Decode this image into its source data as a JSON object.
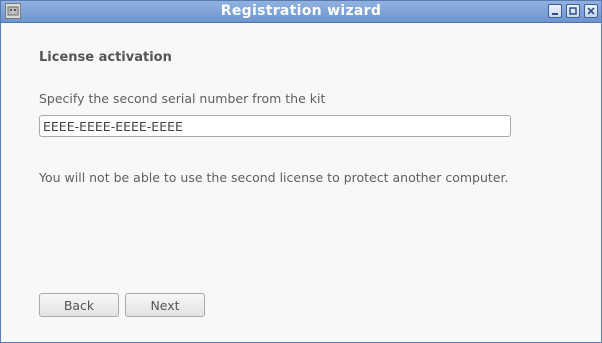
{
  "window": {
    "title": "Registration wizard",
    "app_icon": "wizard-app-icon",
    "controls": {
      "minimize_icon": "minimize-icon",
      "maximize_icon": "maximize-icon",
      "close_icon": "close-icon"
    }
  },
  "page": {
    "heading": "License activation",
    "prompt": "Specify the second serial number from the kit",
    "serial_value": "EEEE-EEEE-EEEE-EEEE",
    "note": "You will not be able to use the second license to protect another computer."
  },
  "buttons": {
    "back_label": "Back",
    "next_label": "Next"
  },
  "colors": {
    "titlebar": "#7aa0d8",
    "window_border": "#5a7bb0",
    "background": "#f8f8f6"
  }
}
